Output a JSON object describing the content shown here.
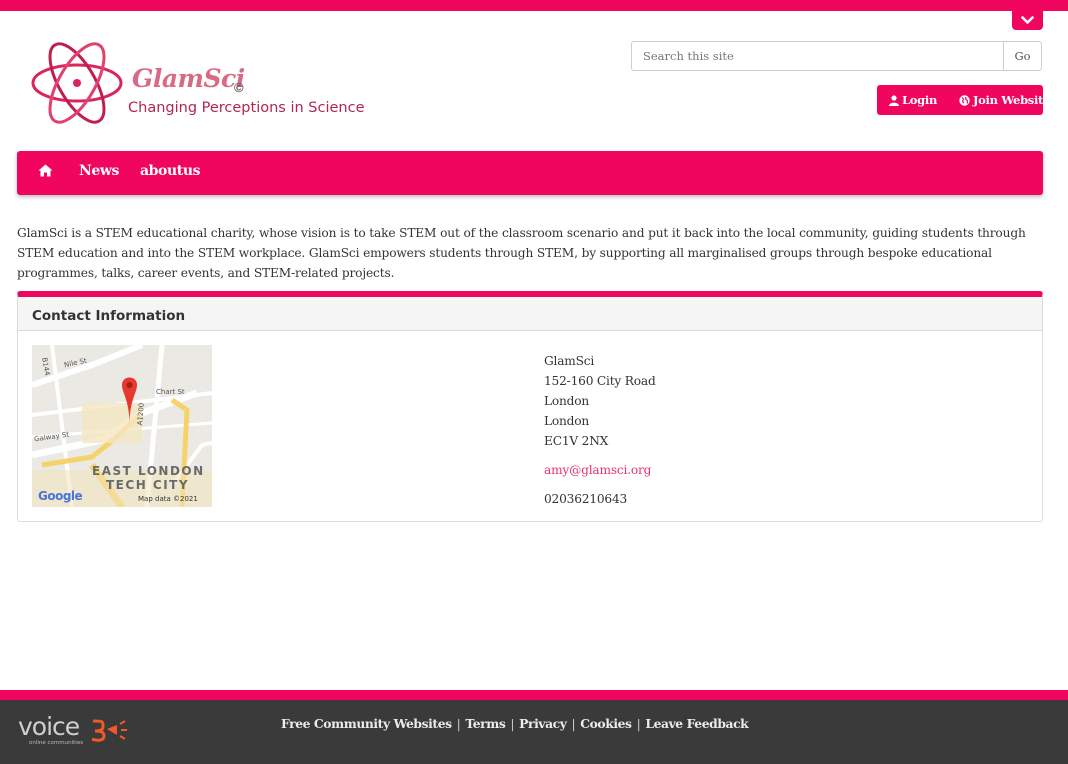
{
  "brand": {
    "name": "GlamSci",
    "copyright_mark": "©",
    "tagline": "Changing Perceptions in Science"
  },
  "search": {
    "placeholder": "Search this site",
    "button_label": "Go"
  },
  "auth": {
    "login_label": "Login",
    "join_label": "Join Website"
  },
  "nav": {
    "items": [
      {
        "label": "News"
      },
      {
        "label": "aboutus"
      }
    ]
  },
  "intro_text": "GlamSci is a STEM educational charity, whose vision is to take STEM out of the classroom scenario and put it back into the local community, guiding students through STEM education and into the STEM workplace. GlamSci empowers students through STEM, by supporting all marginalised groups through bespoke educational programmes, talks, career events, and STEM-related projects.",
  "contact": {
    "title": "Contact Information",
    "map": {
      "labels": [
        "B144",
        "Nile St",
        "Chart St",
        "A1200",
        "Galway St",
        "EAST LONDON",
        "TECH CITY"
      ],
      "provider": "Google",
      "attribution": "Map data ©2021"
    },
    "address": {
      "name": "GlamSci",
      "street": "152-160 City Road",
      "city": "London",
      "region": "London",
      "postcode": "EC1V 2NX"
    },
    "email": "amy@glamsci.org",
    "phone": "02036210643"
  },
  "footer": {
    "logo_word": "voice",
    "logo_sub": "online communities",
    "links": [
      {
        "label": "Free Community Websites"
      },
      {
        "label": "Terms"
      },
      {
        "label": "Privacy"
      },
      {
        "label": "Cookies"
      },
      {
        "label": "Leave Feedback"
      }
    ],
    "separator": "|"
  },
  "colors": {
    "accent": "#f0055f",
    "link": "#e8336f",
    "footer_bg": "#3a3a3a",
    "panel_head_bg": "#f5f5f5"
  }
}
